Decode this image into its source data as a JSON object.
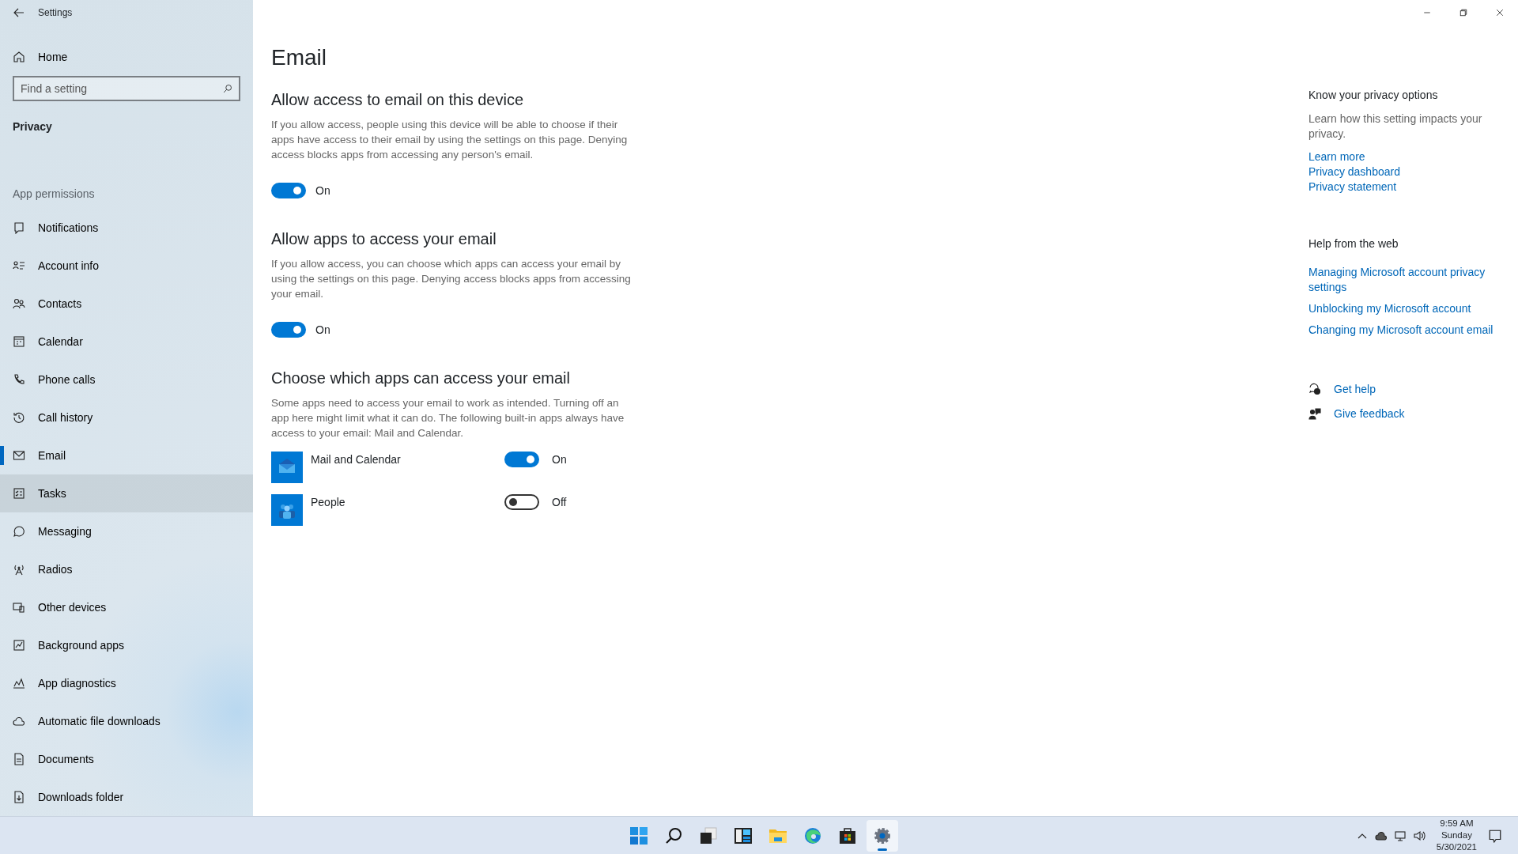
{
  "window": {
    "title": "Settings"
  },
  "sidebar": {
    "home": "Home",
    "search": {
      "placeholder": "Find a setting"
    },
    "section": "Privacy",
    "group": "App permissions",
    "items": [
      {
        "label": "Notifications",
        "selected": false,
        "hovered": false
      },
      {
        "label": "Account info",
        "selected": false,
        "hovered": false
      },
      {
        "label": "Contacts",
        "selected": false,
        "hovered": false
      },
      {
        "label": "Calendar",
        "selected": false,
        "hovered": false
      },
      {
        "label": "Phone calls",
        "selected": false,
        "hovered": false
      },
      {
        "label": "Call history",
        "selected": false,
        "hovered": false
      },
      {
        "label": "Email",
        "selected": true,
        "hovered": false
      },
      {
        "label": "Tasks",
        "selected": false,
        "hovered": true
      },
      {
        "label": "Messaging",
        "selected": false,
        "hovered": false
      },
      {
        "label": "Radios",
        "selected": false,
        "hovered": false
      },
      {
        "label": "Other devices",
        "selected": false,
        "hovered": false
      },
      {
        "label": "Background apps",
        "selected": false,
        "hovered": false
      },
      {
        "label": "App diagnostics",
        "selected": false,
        "hovered": false
      },
      {
        "label": "Automatic file downloads",
        "selected": false,
        "hovered": false
      },
      {
        "label": "Documents",
        "selected": false,
        "hovered": false
      },
      {
        "label": "Downloads folder",
        "selected": false,
        "hovered": false
      }
    ]
  },
  "page": {
    "title": "Email",
    "sections": [
      {
        "heading": "Allow access to email on this device",
        "text": "If you allow access, people using this device will be able to choose if their apps have access to their email by using the settings on this page. Denying access blocks apps from accessing any person's email.",
        "toggle": {
          "on": true,
          "label": "On"
        }
      },
      {
        "heading": "Allow apps to access your email",
        "text": "If you allow access, you can choose which apps can access your email by using the settings on this page. Denying access blocks apps from accessing your email.",
        "toggle": {
          "on": true,
          "label": "On"
        }
      },
      {
        "heading": "Choose which apps can access your email",
        "text": "Some apps need to access your email to work as intended. Turning off an app here might limit what it can do. The following built-in apps always have access to your email: Mail and Calendar."
      }
    ],
    "apps": [
      {
        "name": "Mail and Calendar",
        "on": true,
        "label": "On"
      },
      {
        "name": "People",
        "on": false,
        "label": "Off"
      }
    ]
  },
  "aside": {
    "privacy_heading": "Know your privacy options",
    "privacy_text": "Learn how this setting impacts your privacy.",
    "privacy_links": [
      "Learn more",
      "Privacy dashboard",
      "Privacy statement"
    ],
    "web_heading": "Help from the web",
    "web_links": [
      "Managing Microsoft account privacy settings",
      "Unblocking my Microsoft account",
      "Changing my Microsoft account email"
    ],
    "help": [
      "Get help",
      "Give feedback"
    ]
  },
  "taskbar": {
    "apps": [
      {
        "selected": false
      },
      {
        "selected": false
      },
      {
        "selected": false
      },
      {
        "selected": false
      },
      {
        "selected": false
      },
      {
        "selected": false
      },
      {
        "selected": false
      },
      {
        "selected": true
      }
    ],
    "time": "9:59 AM",
    "day": "Sunday",
    "date": "5/30/2021"
  }
}
